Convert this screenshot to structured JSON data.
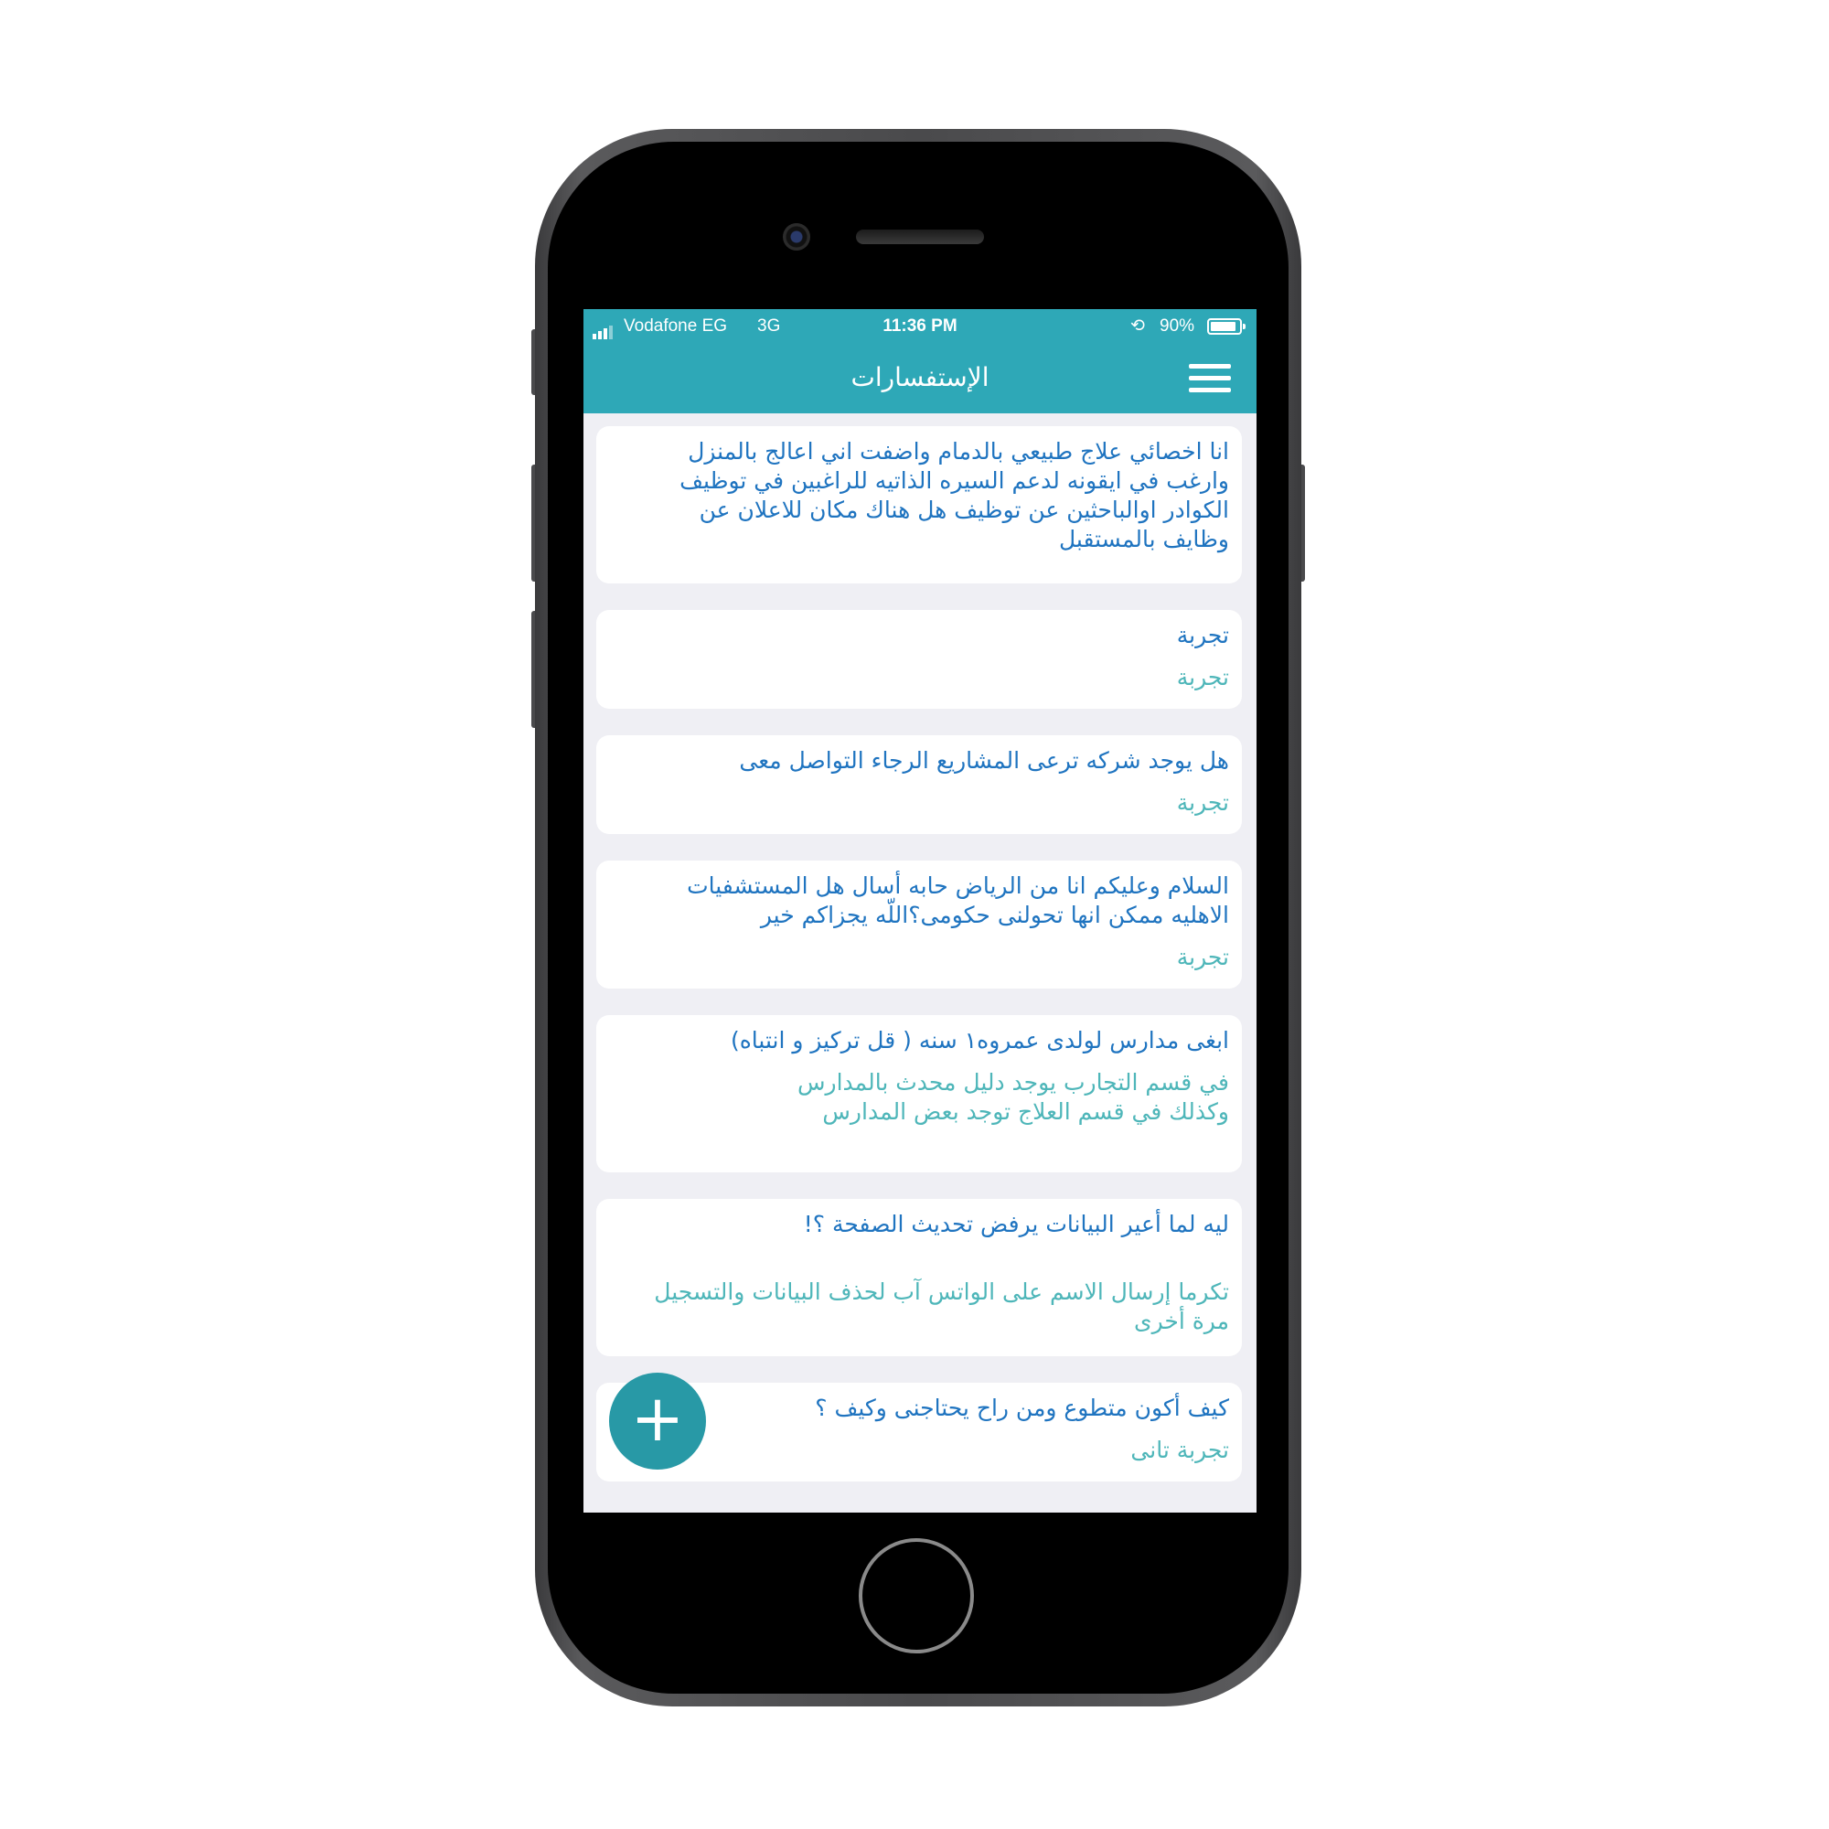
{
  "status_bar": {
    "carrier": "Vodafone EG",
    "network": "3G",
    "time": "11:36 PM",
    "battery_percent": "90%",
    "battery_level": 0.9
  },
  "header": {
    "title": "الإستفسارات",
    "menu_icon": "hamburger-menu-icon"
  },
  "inquiries": [
    {
      "question": "انا اخصائي علاج طبيعي بالدمام  واضفت اني اعالج بالمنزل\nوارغب في ايقونه لدعم السيره الذاتيه للراغبين في توظيف\nالكوادر اوالباحثين عن توظيف هل هناك  مكان للاعلان عن\nوظايف بالمستقبل",
      "answer": ""
    },
    {
      "question": "تجربة",
      "answer": "تجربة"
    },
    {
      "question": "هل يوجد  شركه ترعى المشاريع الرجاء التواصل معى",
      "answer": "تجربة"
    },
    {
      "question": "السلام وعليكم انا من الرياض حابه أسال هل المستشفيات\nالاهليه ممكن انها تحولنى حكومى؟اللّه يجزاكم خير",
      "answer": "تجربة"
    },
    {
      "question": "ابغى مدارس لولدى عمروه١ سنه ( قل تركيز و انتباه)",
      "answer": "في قسم التجارب يوجد دليل محدث بالمدارس\nوكذلك في قسم العلاج توجد بعض المدارس"
    },
    {
      "question": "ليه لما أعير البيانات يرفض تحديث الصفحة ؟!",
      "answer": "تكرما إرسال الاسم على الواتس آب لحذف البيانات والتسجيل\nمرة أخرى"
    },
    {
      "question": "كيف أكون متطوع ومن راح يحتاجنى وكيف ؟",
      "answer": "تجربة تانى"
    }
  ],
  "fab": {
    "label": "+",
    "icon": "plus-icon"
  },
  "colors": {
    "primary": "#2ea8b7",
    "fab": "#2899a6",
    "question_text": "#1f74c0",
    "answer_text": "#4eb6b9",
    "background": "#efeff4"
  }
}
